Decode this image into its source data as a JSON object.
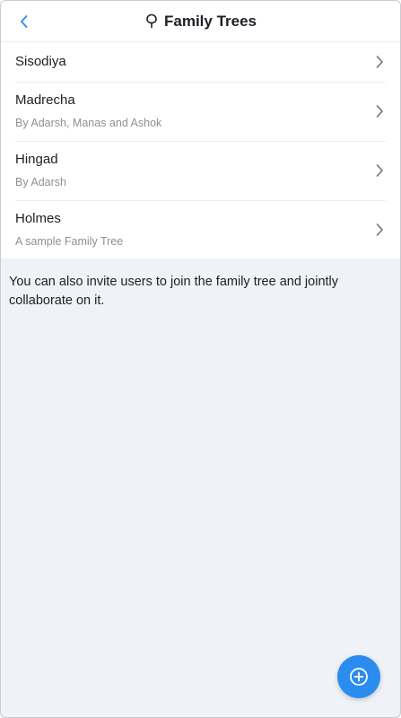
{
  "header": {
    "title": "Family Trees",
    "back_icon": "chevron-left-icon",
    "title_icon": "tree-icon"
  },
  "trees": [
    {
      "name": "Sisodiya",
      "subtitle": ""
    },
    {
      "name": "Madrecha",
      "subtitle": "By Adarsh, Manas and Ashok"
    },
    {
      "name": "Hingad",
      "subtitle": "By Adarsh"
    },
    {
      "name": "Holmes",
      "subtitle": "A sample Family Tree"
    }
  ],
  "info_text": "You can also invite users to join the family tree and jointly collaborate on it.",
  "fab": {
    "icon": "plus-circle-icon"
  },
  "colors": {
    "accent": "#2b8cf0",
    "background": "#eff2f6",
    "text": "#1c1f24",
    "subtext": "#8d9096"
  }
}
